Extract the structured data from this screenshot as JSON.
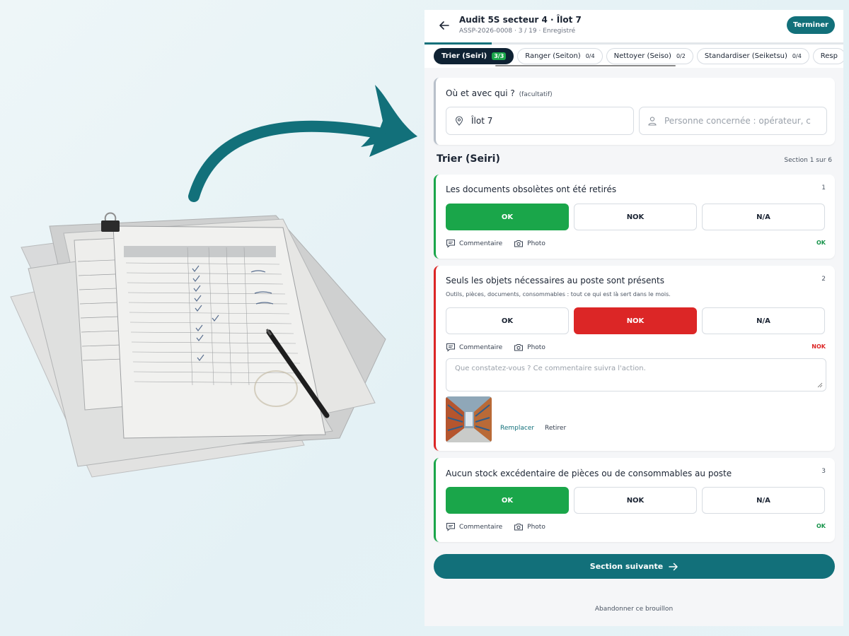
{
  "header": {
    "title": "Audit 5S secteur 4 · Îlot 7",
    "subtitle": "ASSP-2026-0008 · 3 / 19 · Enregistré",
    "finish_label": "Terminer",
    "progress_fraction": 0.16
  },
  "tabs": [
    {
      "label": "Trier (Seiri)",
      "count": "3/3",
      "active": true
    },
    {
      "label": "Ranger (Seiton)",
      "count": "0/4",
      "active": false
    },
    {
      "label": "Nettoyer (Seiso)",
      "count": "0/2",
      "active": false
    },
    {
      "label": "Standardiser (Seiketsu)",
      "count": "0/4",
      "active": false
    },
    {
      "label": "Resp",
      "count": "",
      "active": false
    }
  ],
  "location": {
    "title": "Où et avec qui ?",
    "optional": "(facultatif)",
    "place_value": "Îlot 7",
    "person_placeholder": "Personne concernée : opérateur, c"
  },
  "section": {
    "title": "Trier (Seiri)",
    "counter": "Section 1 sur 6"
  },
  "answers": {
    "ok": "OK",
    "nok": "NOK",
    "na": "N/A"
  },
  "actions": {
    "comment": "Commentaire",
    "photo": "Photo"
  },
  "questions": [
    {
      "number": "1",
      "title": "Les documents obsolètes ont été retirés",
      "status": "OK"
    },
    {
      "number": "2",
      "title": "Seuls les objets nécessaires au poste sont présents",
      "description": "Outils, pièces, documents, consommables : tout ce qui est là sert dans le mois.",
      "status": "NOK",
      "comment_placeholder": "Que constatez-vous ? Ce commentaire suivra l'action.",
      "photo_replace": "Remplacer",
      "photo_remove": "Retirer"
    },
    {
      "number": "3",
      "title": "Aucun stock excédentaire de pièces ou de consommables au poste",
      "status": "OK"
    }
  ],
  "footer": {
    "next_label": "Section suivante",
    "abandon_label": "Abandonner ce brouillon"
  },
  "colors": {
    "brand": "#12707a",
    "ok": "#1aa64a",
    "nok": "#dc2626",
    "tab_active": "#0f2233"
  },
  "icons": [
    "back-arrow-icon",
    "location-pin-icon",
    "person-icon",
    "comment-icon",
    "camera-icon",
    "arrow-right-icon",
    "paper-clip-icon",
    "pen-icon",
    "curved-arrow-icon"
  ]
}
